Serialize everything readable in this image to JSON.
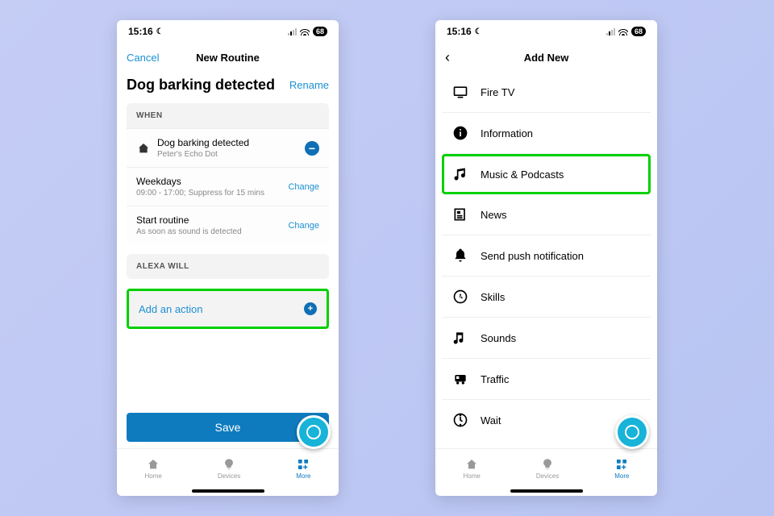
{
  "statusbar": {
    "time": "15:16",
    "battery": "68"
  },
  "left": {
    "nav": {
      "cancel": "Cancel",
      "title": "New Routine"
    },
    "routine": {
      "name": "Dog barking detected",
      "rename": "Rename"
    },
    "when": {
      "header": "WHEN",
      "trigger": {
        "title": "Dog barking detected",
        "subtitle": "Peter's Echo Dot"
      },
      "schedule": {
        "title": "Weekdays",
        "subtitle": "09:00 - 17:00; Suppress for 15 mins",
        "action": "Change"
      },
      "start": {
        "title": "Start routine",
        "subtitle": "As soon as sound is detected",
        "action": "Change"
      }
    },
    "alexa": {
      "header": "ALEXA WILL",
      "add_action": "Add an action"
    },
    "save": "Save"
  },
  "right": {
    "nav": {
      "title": "Add New"
    },
    "items": [
      {
        "label": "Fire TV",
        "icon": "tv"
      },
      {
        "label": "Information",
        "icon": "info"
      },
      {
        "label": "Music & Podcasts",
        "icon": "music",
        "highlight": true
      },
      {
        "label": "News",
        "icon": "news"
      },
      {
        "label": "Send push notification",
        "icon": "bell"
      },
      {
        "label": "Skills",
        "icon": "skills"
      },
      {
        "label": "Sounds",
        "icon": "sounds"
      },
      {
        "label": "Traffic",
        "icon": "traffic"
      },
      {
        "label": "Wait",
        "icon": "wait"
      }
    ]
  },
  "tabs": {
    "home": "Home",
    "devices": "Devices",
    "more": "More"
  }
}
